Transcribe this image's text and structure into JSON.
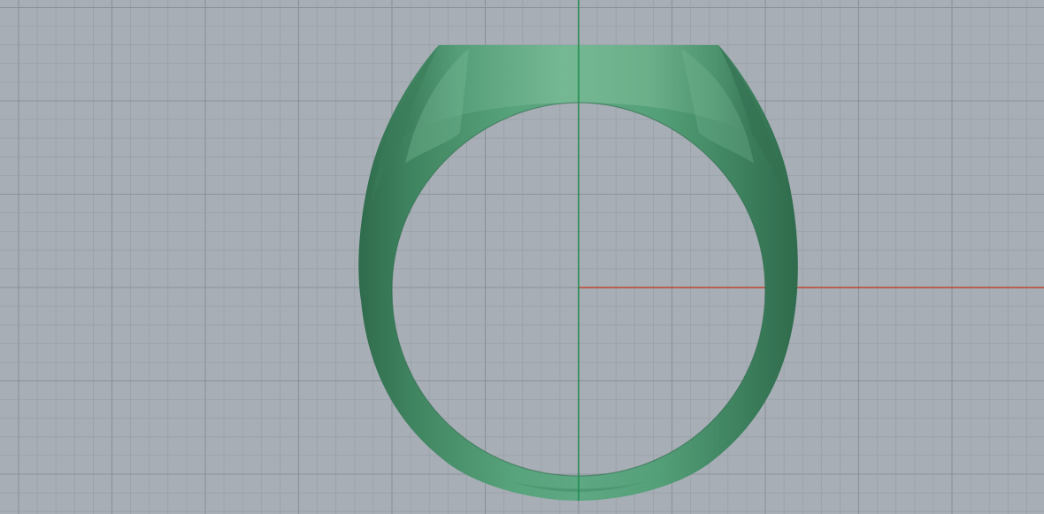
{
  "viewport": {
    "view": "front",
    "background_color": "#a7aeb6",
    "grid": {
      "visible": true,
      "minor_line_color": "#98a0a8",
      "major_line_color": "#8a929a"
    },
    "axes": {
      "x_axis_color": "#c0452e",
      "y_axis_color": "#1f8a4c",
      "positive_directions_visible": [
        "x",
        "y"
      ]
    },
    "model": {
      "object": "signet-ring",
      "material_color": "#4f9a72",
      "highlight_color": "#79bb96",
      "shadow_color": "#2f6b4c"
    }
  }
}
